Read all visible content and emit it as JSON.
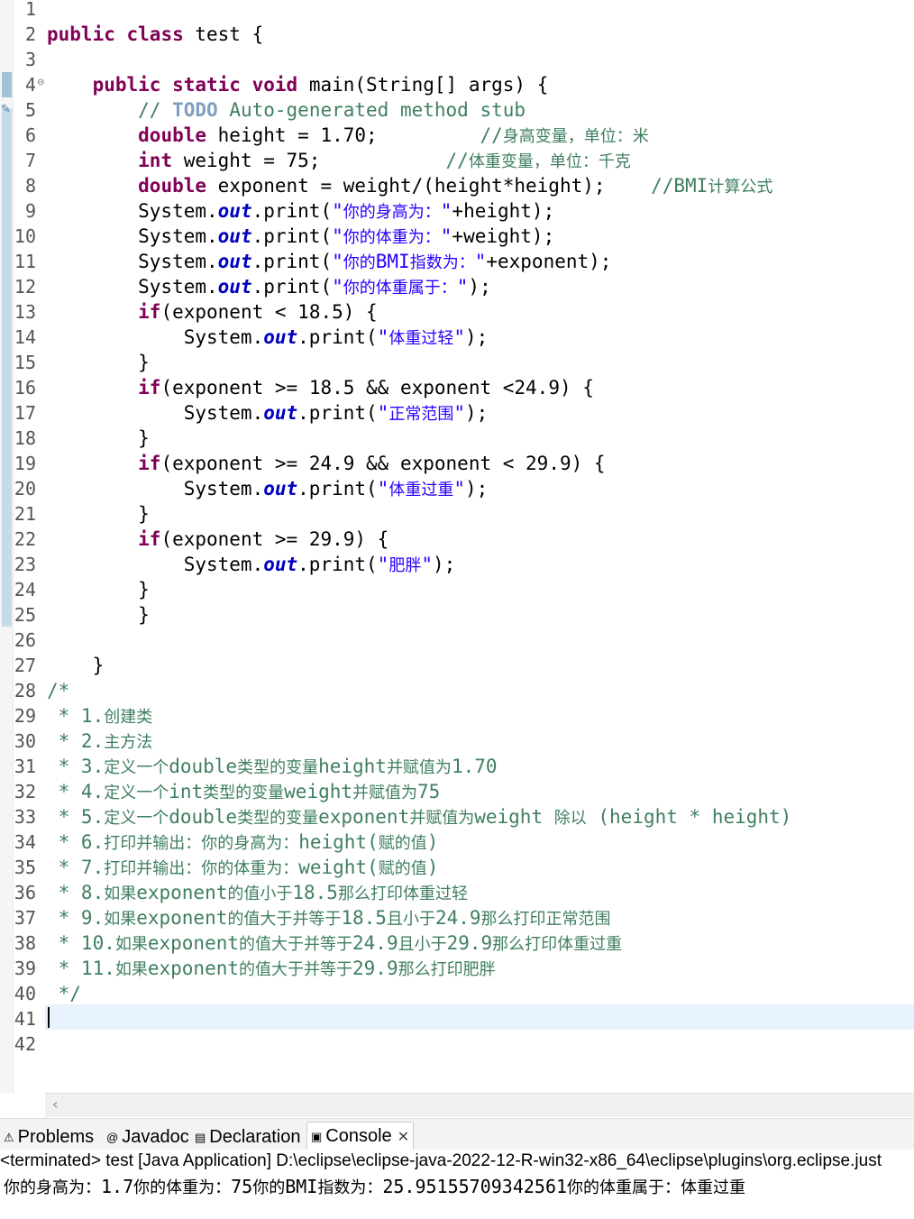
{
  "editor": {
    "file": "test.java",
    "lines": [
      {
        "n": "1",
        "segs": []
      },
      {
        "n": "2",
        "segs": [
          {
            "t": "public",
            "c": "kw"
          },
          {
            "t": " "
          },
          {
            "t": "class",
            "c": "kw"
          },
          {
            "t": " test {"
          }
        ]
      },
      {
        "n": "3",
        "segs": []
      },
      {
        "n": "4",
        "segs": [
          {
            "t": "    "
          },
          {
            "t": "public",
            "c": "kw"
          },
          {
            "t": " "
          },
          {
            "t": "static",
            "c": "kw"
          },
          {
            "t": " "
          },
          {
            "t": "void",
            "c": "kw"
          },
          {
            "t": " main(String[] args) {"
          }
        ]
      },
      {
        "n": "5",
        "segs": [
          {
            "t": "        "
          },
          {
            "t": "// ",
            "c": "cm"
          },
          {
            "t": "TODO",
            "c": "todo"
          },
          {
            "t": " Auto-generated method stub",
            "c": "cm"
          }
        ]
      },
      {
        "n": "6",
        "segs": [
          {
            "t": "        "
          },
          {
            "t": "double",
            "c": "kw"
          },
          {
            "t": " height = 1.70;         "
          },
          {
            "t": "//身高变量，单位：米",
            "c": "cm"
          }
        ]
      },
      {
        "n": "7",
        "segs": [
          {
            "t": "        "
          },
          {
            "t": "int",
            "c": "kw"
          },
          {
            "t": " weight = 75;           "
          },
          {
            "t": "//体重变量，单位：千克",
            "c": "cm"
          }
        ]
      },
      {
        "n": "8",
        "segs": [
          {
            "t": "        "
          },
          {
            "t": "double",
            "c": "kw"
          },
          {
            "t": " exponent = weight/(height*height);    "
          },
          {
            "t": "//BMI计算公式",
            "c": "cm"
          }
        ]
      },
      {
        "n": "9",
        "segs": [
          {
            "t": "        System."
          },
          {
            "t": "out",
            "c": "fld"
          },
          {
            "t": ".print("
          },
          {
            "t": "\"你的身高为：\"",
            "c": "str"
          },
          {
            "t": "+height);"
          }
        ]
      },
      {
        "n": "10",
        "segs": [
          {
            "t": "        System."
          },
          {
            "t": "out",
            "c": "fld"
          },
          {
            "t": ".print("
          },
          {
            "t": "\"你的体重为：\"",
            "c": "str"
          },
          {
            "t": "+weight);"
          }
        ]
      },
      {
        "n": "11",
        "segs": [
          {
            "t": "        System."
          },
          {
            "t": "out",
            "c": "fld"
          },
          {
            "t": ".print("
          },
          {
            "t": "\"你的BMI指数为：\"",
            "c": "str"
          },
          {
            "t": "+exponent);"
          }
        ]
      },
      {
        "n": "12",
        "segs": [
          {
            "t": "        System."
          },
          {
            "t": "out",
            "c": "fld"
          },
          {
            "t": ".print("
          },
          {
            "t": "\"你的体重属于：\"",
            "c": "str"
          },
          {
            "t": ");"
          }
        ]
      },
      {
        "n": "13",
        "segs": [
          {
            "t": "        "
          },
          {
            "t": "if",
            "c": "kw"
          },
          {
            "t": "(exponent < 18.5) {"
          }
        ]
      },
      {
        "n": "14",
        "segs": [
          {
            "t": "            System."
          },
          {
            "t": "out",
            "c": "fld"
          },
          {
            "t": ".print("
          },
          {
            "t": "\"体重过轻\"",
            "c": "str"
          },
          {
            "t": ");"
          }
        ]
      },
      {
        "n": "15",
        "segs": [
          {
            "t": "        }"
          }
        ]
      },
      {
        "n": "16",
        "segs": [
          {
            "t": "        "
          },
          {
            "t": "if",
            "c": "kw"
          },
          {
            "t": "(exponent >= 18.5 && exponent <24.9) {"
          }
        ]
      },
      {
        "n": "17",
        "segs": [
          {
            "t": "            System."
          },
          {
            "t": "out",
            "c": "fld"
          },
          {
            "t": ".print("
          },
          {
            "t": "\"正常范围\"",
            "c": "str"
          },
          {
            "t": ");"
          }
        ]
      },
      {
        "n": "18",
        "segs": [
          {
            "t": "        }"
          }
        ]
      },
      {
        "n": "19",
        "segs": [
          {
            "t": "        "
          },
          {
            "t": "if",
            "c": "kw"
          },
          {
            "t": "(exponent >= 24.9 && exponent < 29.9) {"
          }
        ]
      },
      {
        "n": "20",
        "segs": [
          {
            "t": "            System."
          },
          {
            "t": "out",
            "c": "fld"
          },
          {
            "t": ".print("
          },
          {
            "t": "\"体重过重\"",
            "c": "str"
          },
          {
            "t": ");"
          }
        ]
      },
      {
        "n": "21",
        "segs": [
          {
            "t": "        }"
          }
        ]
      },
      {
        "n": "22",
        "segs": [
          {
            "t": "        "
          },
          {
            "t": "if",
            "c": "kw"
          },
          {
            "t": "(exponent >= 29.9) {"
          }
        ]
      },
      {
        "n": "23",
        "segs": [
          {
            "t": "            System."
          },
          {
            "t": "out",
            "c": "fld"
          },
          {
            "t": ".print("
          },
          {
            "t": "\"肥胖\"",
            "c": "str"
          },
          {
            "t": ");"
          }
        ]
      },
      {
        "n": "24",
        "segs": [
          {
            "t": "        }"
          }
        ]
      },
      {
        "n": "25",
        "segs": [
          {
            "t": "        }"
          }
        ]
      },
      {
        "n": "26",
        "segs": []
      },
      {
        "n": "27",
        "segs": [
          {
            "t": "    }"
          }
        ]
      },
      {
        "n": "28",
        "segs": [
          {
            "t": "/*",
            "c": "cm"
          }
        ]
      },
      {
        "n": "29",
        "segs": [
          {
            "t": " * 1.创建类",
            "c": "cm"
          }
        ]
      },
      {
        "n": "30",
        "segs": [
          {
            "t": " * 2.主方法",
            "c": "cm"
          }
        ]
      },
      {
        "n": "31",
        "segs": [
          {
            "t": " * 3.定义一个double类型的变量height并赋值为1.70",
            "c": "cm"
          }
        ]
      },
      {
        "n": "32",
        "segs": [
          {
            "t": " * 4.定义一个int类型的变量weight并赋值为75",
            "c": "cm"
          }
        ]
      },
      {
        "n": "33",
        "segs": [
          {
            "t": " * 5.定义一个double类型的变量exponent并赋值为weight 除以 (height * height)",
            "c": "cm"
          }
        ]
      },
      {
        "n": "34",
        "segs": [
          {
            "t": " * 6.打印并输出：你的身高为：height(赋的值)",
            "c": "cm"
          }
        ]
      },
      {
        "n": "35",
        "segs": [
          {
            "t": " * 7.打印并输出：你的体重为：weight(赋的值)",
            "c": "cm"
          }
        ]
      },
      {
        "n": "36",
        "segs": [
          {
            "t": " * 8.如果exponent的值小于18.5那么打印体重过轻",
            "c": "cm"
          }
        ]
      },
      {
        "n": "37",
        "segs": [
          {
            "t": " * 9.如果exponent的值大于并等于18.5且小于24.9那么打印正常范围",
            "c": "cm"
          }
        ]
      },
      {
        "n": "38",
        "segs": [
          {
            "t": " * 10.如果exponent的值大于并等于24.9且小于29.9那么打印体重过重",
            "c": "cm"
          }
        ]
      },
      {
        "n": "39",
        "segs": [
          {
            "t": " * 11.如果exponent的值大于并等于29.9那么打印肥胖",
            "c": "cm"
          }
        ]
      },
      {
        "n": "40",
        "segs": [
          {
            "t": " */",
            "c": "cm"
          }
        ]
      },
      {
        "n": "41",
        "segs": []
      },
      {
        "n": "42",
        "segs": []
      }
    ]
  },
  "bottom_panel": {
    "tabs": [
      {
        "label": "Problems",
        "icon": "problems-icon",
        "glyph": "⚠",
        "active": false
      },
      {
        "label": "Javadoc",
        "icon": "javadoc-icon",
        "glyph": "@",
        "active": false
      },
      {
        "label": "Declaration",
        "icon": "declaration-icon",
        "glyph": "▤",
        "active": false
      },
      {
        "label": "Console",
        "icon": "console-icon",
        "glyph": "▣",
        "active": true
      }
    ],
    "close_glyph": "✕",
    "status": "<terminated> test [Java Application] D:\\eclipse\\eclipse-java-2022-12-R-win32-x86_64\\eclipse\\plugins\\org.eclipse.just",
    "output": "你的身高为：1.7你的体重为：75你的BMI指数为：25.951557093425​61你的体重属于：体重过重"
  },
  "colors": {
    "keyword": "#7f0055",
    "string": "#2a00ff",
    "comment": "#3f7f5f",
    "field": "#0000c0",
    "todo": "#7f9fbf",
    "current_line": "#e8f2fe"
  }
}
